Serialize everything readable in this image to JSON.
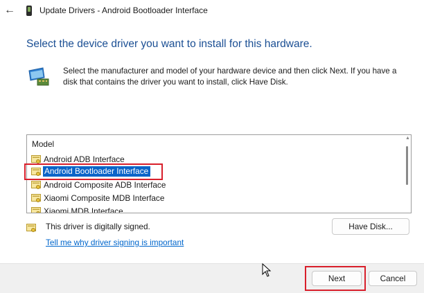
{
  "window": {
    "title": "Update Drivers - Android Bootloader Interface"
  },
  "heading": "Select the device driver you want to install for this hardware.",
  "instructions": "Select the manufacturer and model of your hardware device and then click Next. If you have a disk that contains the driver you want to install, click Have Disk.",
  "model_list": {
    "header": "Model",
    "items": [
      {
        "label": "Android ADB Interface",
        "selected": false
      },
      {
        "label": "Android Bootloader Interface",
        "selected": true
      },
      {
        "label": "Android Composite ADB Interface",
        "selected": false
      },
      {
        "label": "Xiaomi Composite MDB Interface",
        "selected": false
      },
      {
        "label": "Xiaomi MDB Interface",
        "selected": false
      }
    ]
  },
  "signing": {
    "status_text": "This driver is digitally signed.",
    "link_text": "Tell me why driver signing is important"
  },
  "buttons": {
    "have_disk": "Have Disk...",
    "next": "Next",
    "cancel": "Cancel"
  },
  "colors": {
    "heading": "#1a4e93",
    "selection": "#0a64c8",
    "highlight_box": "#d81e2a",
    "link": "#0066cc"
  }
}
